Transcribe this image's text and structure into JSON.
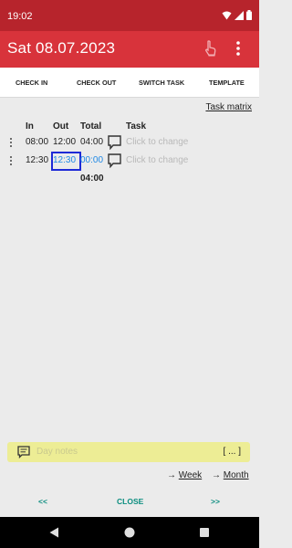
{
  "status_bar": {
    "time": "19:02"
  },
  "app_bar": {
    "title": "Sat 08.07.2023"
  },
  "tabs": [
    {
      "label": "CHECK IN"
    },
    {
      "label": "CHECK OUT"
    },
    {
      "label": "SWITCH TASK"
    },
    {
      "label": "TEMPLATE"
    }
  ],
  "task_matrix_link": "Task matrix",
  "table": {
    "headers": {
      "in": "In",
      "out": "Out",
      "total": "Total",
      "task": "Task"
    },
    "rows": [
      {
        "in": "08:00",
        "out": "12:00",
        "total": "04:00",
        "task_placeholder": "Click to change"
      },
      {
        "in": "12:30",
        "out": "12:30",
        "total": "00:00",
        "task_placeholder": "Click to change"
      }
    ],
    "sum_total": "04:00"
  },
  "day_notes": {
    "placeholder": "Day notes",
    "expand_label": "[ ... ]"
  },
  "links": {
    "week_arrow": "→",
    "week": "Week",
    "month_arrow": "→",
    "month": "Month"
  },
  "bottom_buttons": {
    "prev": "<<",
    "close": "CLOSE",
    "next": ">>"
  },
  "colors": {
    "status_bar": "#b7242c",
    "app_bar": "#d8333b",
    "accent_blue": "#1e88e5",
    "teal": "#0a8d7f",
    "notes_bg": "#eded95"
  }
}
